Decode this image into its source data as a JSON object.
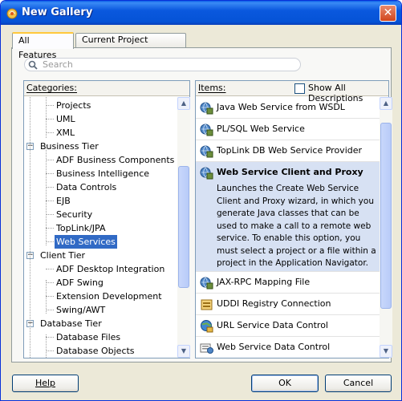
{
  "window": {
    "title": "New Gallery",
    "close_symbol": "✕"
  },
  "tabs": [
    {
      "label": "All Features",
      "active": true
    },
    {
      "label": "Current Project Features",
      "active": false
    }
  ],
  "search": {
    "placeholder": "Search"
  },
  "categories": {
    "header": "Categories:",
    "rows": [
      {
        "label": "Projects",
        "level": 1
      },
      {
        "label": "UML",
        "level": 1
      },
      {
        "label": "XML",
        "level": 1
      },
      {
        "label": "Business Tier",
        "level": 0,
        "expanded": true
      },
      {
        "label": "ADF Business Components",
        "level": 1
      },
      {
        "label": "Business Intelligence",
        "level": 1
      },
      {
        "label": "Data Controls",
        "level": 1
      },
      {
        "label": "EJB",
        "level": 1
      },
      {
        "label": "Security",
        "level": 1
      },
      {
        "label": "TopLink/JPA",
        "level": 1
      },
      {
        "label": "Web Services",
        "level": 1,
        "selected": true
      },
      {
        "label": "Client Tier",
        "level": 0,
        "expanded": true
      },
      {
        "label": "ADF Desktop Integration",
        "level": 1
      },
      {
        "label": "ADF Swing",
        "level": 1
      },
      {
        "label": "Extension Development",
        "level": 1
      },
      {
        "label": "Swing/AWT",
        "level": 1
      },
      {
        "label": "Database Tier",
        "level": 0,
        "expanded": true
      },
      {
        "label": "Database Files",
        "level": 1
      },
      {
        "label": "Database Objects",
        "level": 1
      }
    ]
  },
  "items": {
    "header": "Items:",
    "show_all_label": "Show All Descriptions",
    "show_all_checked": false,
    "list": [
      {
        "label": "Java Web Service from WSDL",
        "icon": "web-service-icon"
      },
      {
        "label": "PL/SQL Web Service",
        "icon": "web-service-icon"
      },
      {
        "label": "TopLink DB Web Service Provider",
        "icon": "web-service-icon"
      },
      {
        "label": "Web Service Client and Proxy",
        "icon": "web-service-icon",
        "selected": true,
        "description": "Launches the Create Web Service Client and Proxy wizard, in which you generate Java classes that can be used to make a call to a remote web service. To enable this option, you must select a project or a file within a project in the Application Navigator."
      },
      {
        "label": "JAX-RPC Mapping File",
        "icon": "web-service-icon"
      },
      {
        "label": "UDDI Registry Connection",
        "icon": "uddi-registry-icon"
      },
      {
        "label": "URL Service Data Control",
        "icon": "url-data-control-icon"
      },
      {
        "label": "Web Service Data Control",
        "icon": "web-service-data-control-icon"
      }
    ]
  },
  "buttons": {
    "help": "Help",
    "ok": "OK",
    "cancel": "Cancel"
  },
  "colors": {
    "titlebar": "#0a58de",
    "selection": "#316ac5",
    "highlight": "#d7e1f3",
    "dialog_bg": "#ece9d8"
  }
}
